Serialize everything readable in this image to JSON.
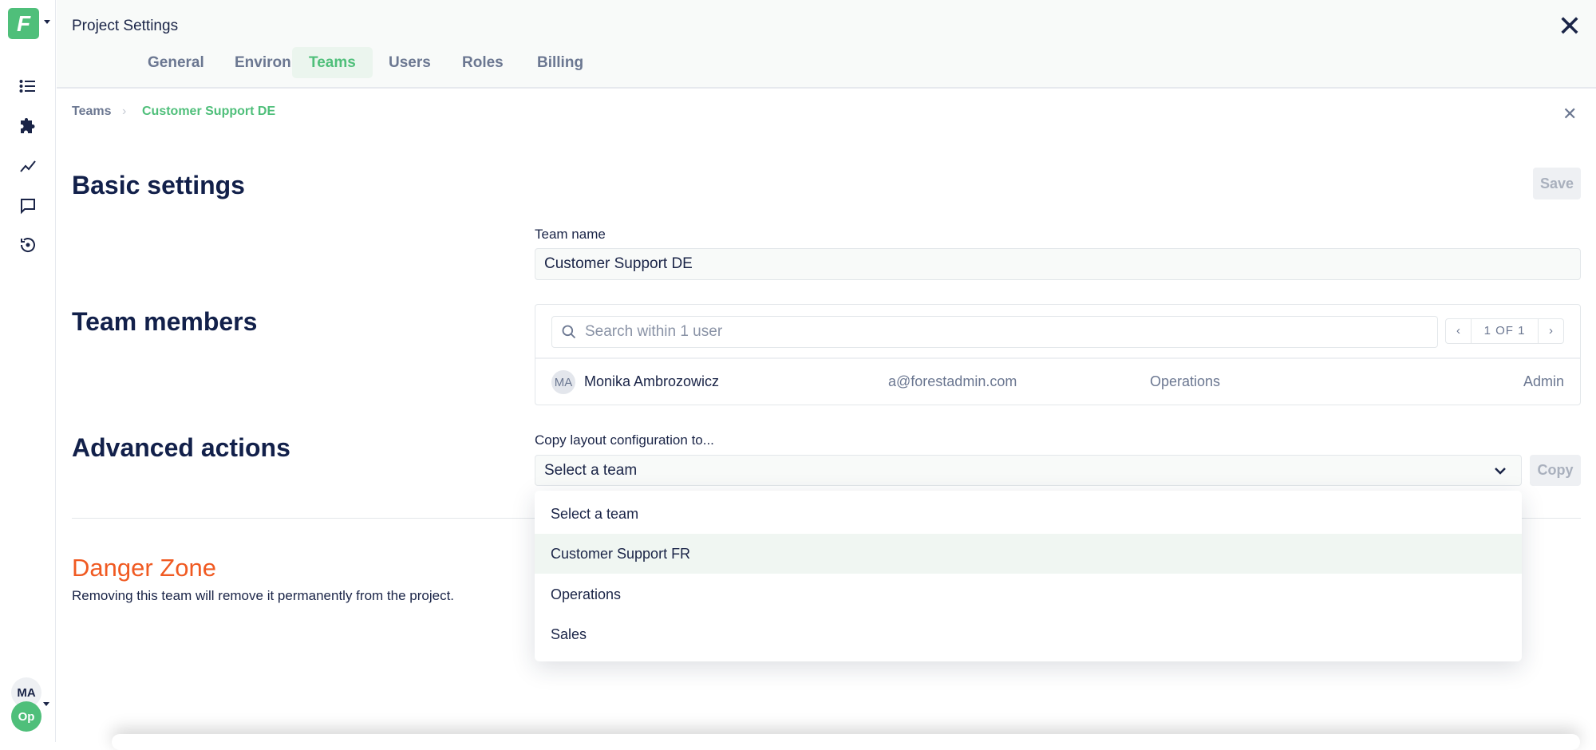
{
  "colors": {
    "accent": "#4fbf7a",
    "danger": "#f05a22"
  },
  "sidebar": {
    "logo": "F",
    "icons": [
      "list-icon",
      "puzzle-icon",
      "chart-line-icon",
      "message-icon",
      "history-icon"
    ],
    "user_initials": "MA",
    "team_initials": "Op"
  },
  "header": {
    "title": "Project Settings",
    "tabs": [
      {
        "label": "General"
      },
      {
        "label": "Environments"
      },
      {
        "label": "Teams"
      },
      {
        "label": "Users"
      },
      {
        "label": "Roles"
      },
      {
        "label": "Billing"
      }
    ],
    "active_tab": "Teams"
  },
  "breadcrumb": {
    "parent": "Teams",
    "current": "Customer Support DE"
  },
  "basic": {
    "title": "Basic settings",
    "save": "Save",
    "team_name_label": "Team name",
    "team_name_value": "Customer Support DE"
  },
  "members": {
    "title": "Team members",
    "search_placeholder": "Search within 1 user",
    "pager": "1 OF 1",
    "rows": [
      {
        "initials": "MA",
        "name": "Monika Ambrozowicz",
        "email": "a@forestadmin.com",
        "team": "Operations",
        "role": "Admin"
      }
    ]
  },
  "advanced": {
    "title": "Advanced actions",
    "copy_label": "Copy layout configuration to...",
    "select_value": "Select a team",
    "copy": "Copy",
    "options": [
      "Select a team",
      "Customer Support FR",
      "Operations",
      "Sales"
    ],
    "highlighted": "Customer Support FR"
  },
  "danger": {
    "title": "Danger Zone",
    "text": "Removing this team will remove it permanently from the project."
  }
}
